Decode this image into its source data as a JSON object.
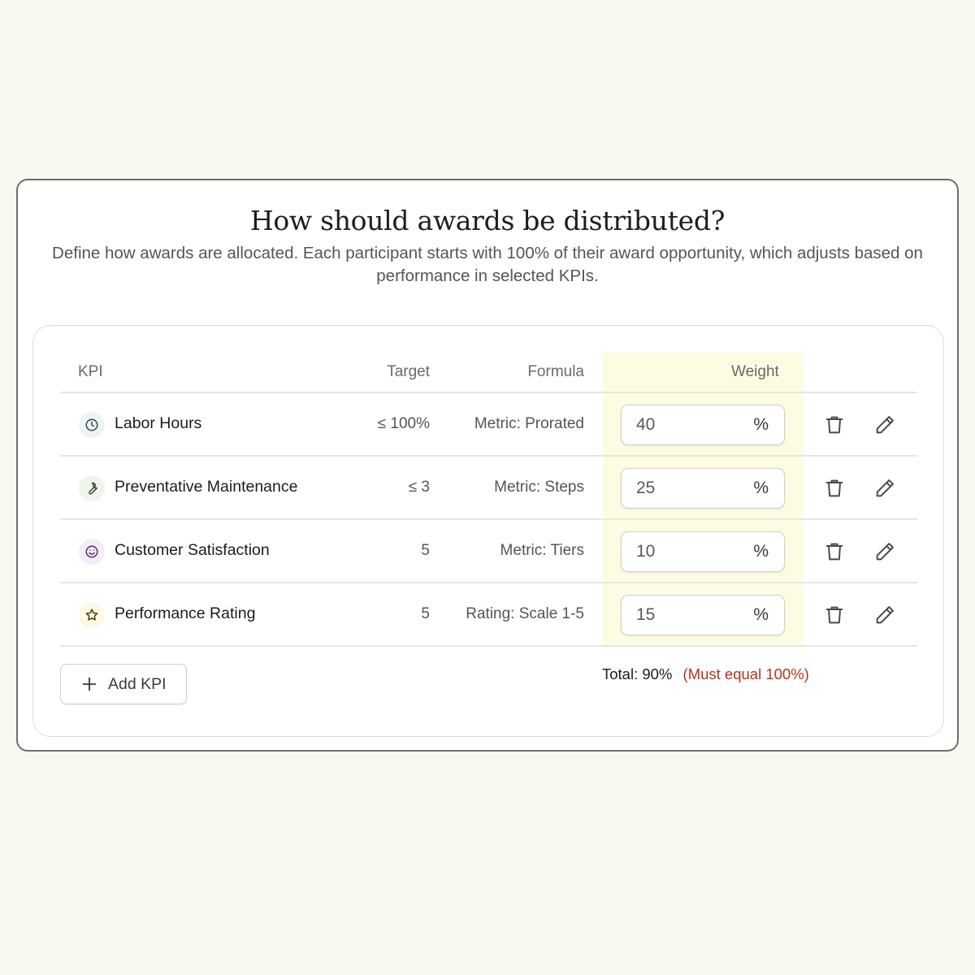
{
  "title": "How should awards be distributed?",
  "subtitle": "Define how awards are allocated. Each participant starts with 100% of their award opportunity, which adjusts based on performance in selected KPIs.",
  "table": {
    "headers": {
      "kpi": "KPI",
      "target": "Target",
      "formula": "Formula",
      "weight": "Weight"
    },
    "rows": [
      {
        "name": "Labor Hours",
        "icon": "clock-icon",
        "icon_bg": "#eef3f6",
        "icon_color": "#2f4b57",
        "target": "≤ 100%",
        "formula": "Metric: Prorated",
        "weight": "40",
        "unit": "%"
      },
      {
        "name": "Preventative Maintenance",
        "icon": "wrench-icon",
        "icon_bg": "#eff4ec",
        "icon_color": "#2f4a2a",
        "target": "≤ 3",
        "formula": "Metric: Steps",
        "weight": "25",
        "unit": "%"
      },
      {
        "name": "Customer Satisfaction",
        "icon": "smiley-icon",
        "icon_bg": "#f4ecf7",
        "icon_color": "#5a2d6b",
        "target": "5",
        "formula": "Metric: Tiers",
        "weight": "10",
        "unit": "%"
      },
      {
        "name": "Performance Rating",
        "icon": "star-icon",
        "icon_bg": "#fcf8e4",
        "icon_color": "#4a3f10",
        "target": "5",
        "formula": "Rating: Scale 1-5",
        "weight": "15",
        "unit": "%"
      }
    ]
  },
  "add_button_label": "Add KPI",
  "total_label": "Total: 90%",
  "warning_label": "(Must equal 100%)",
  "colors": {
    "background": "#f9f8ef",
    "weight_column_highlight": "#fefbe3",
    "warning": "#b5331f"
  }
}
